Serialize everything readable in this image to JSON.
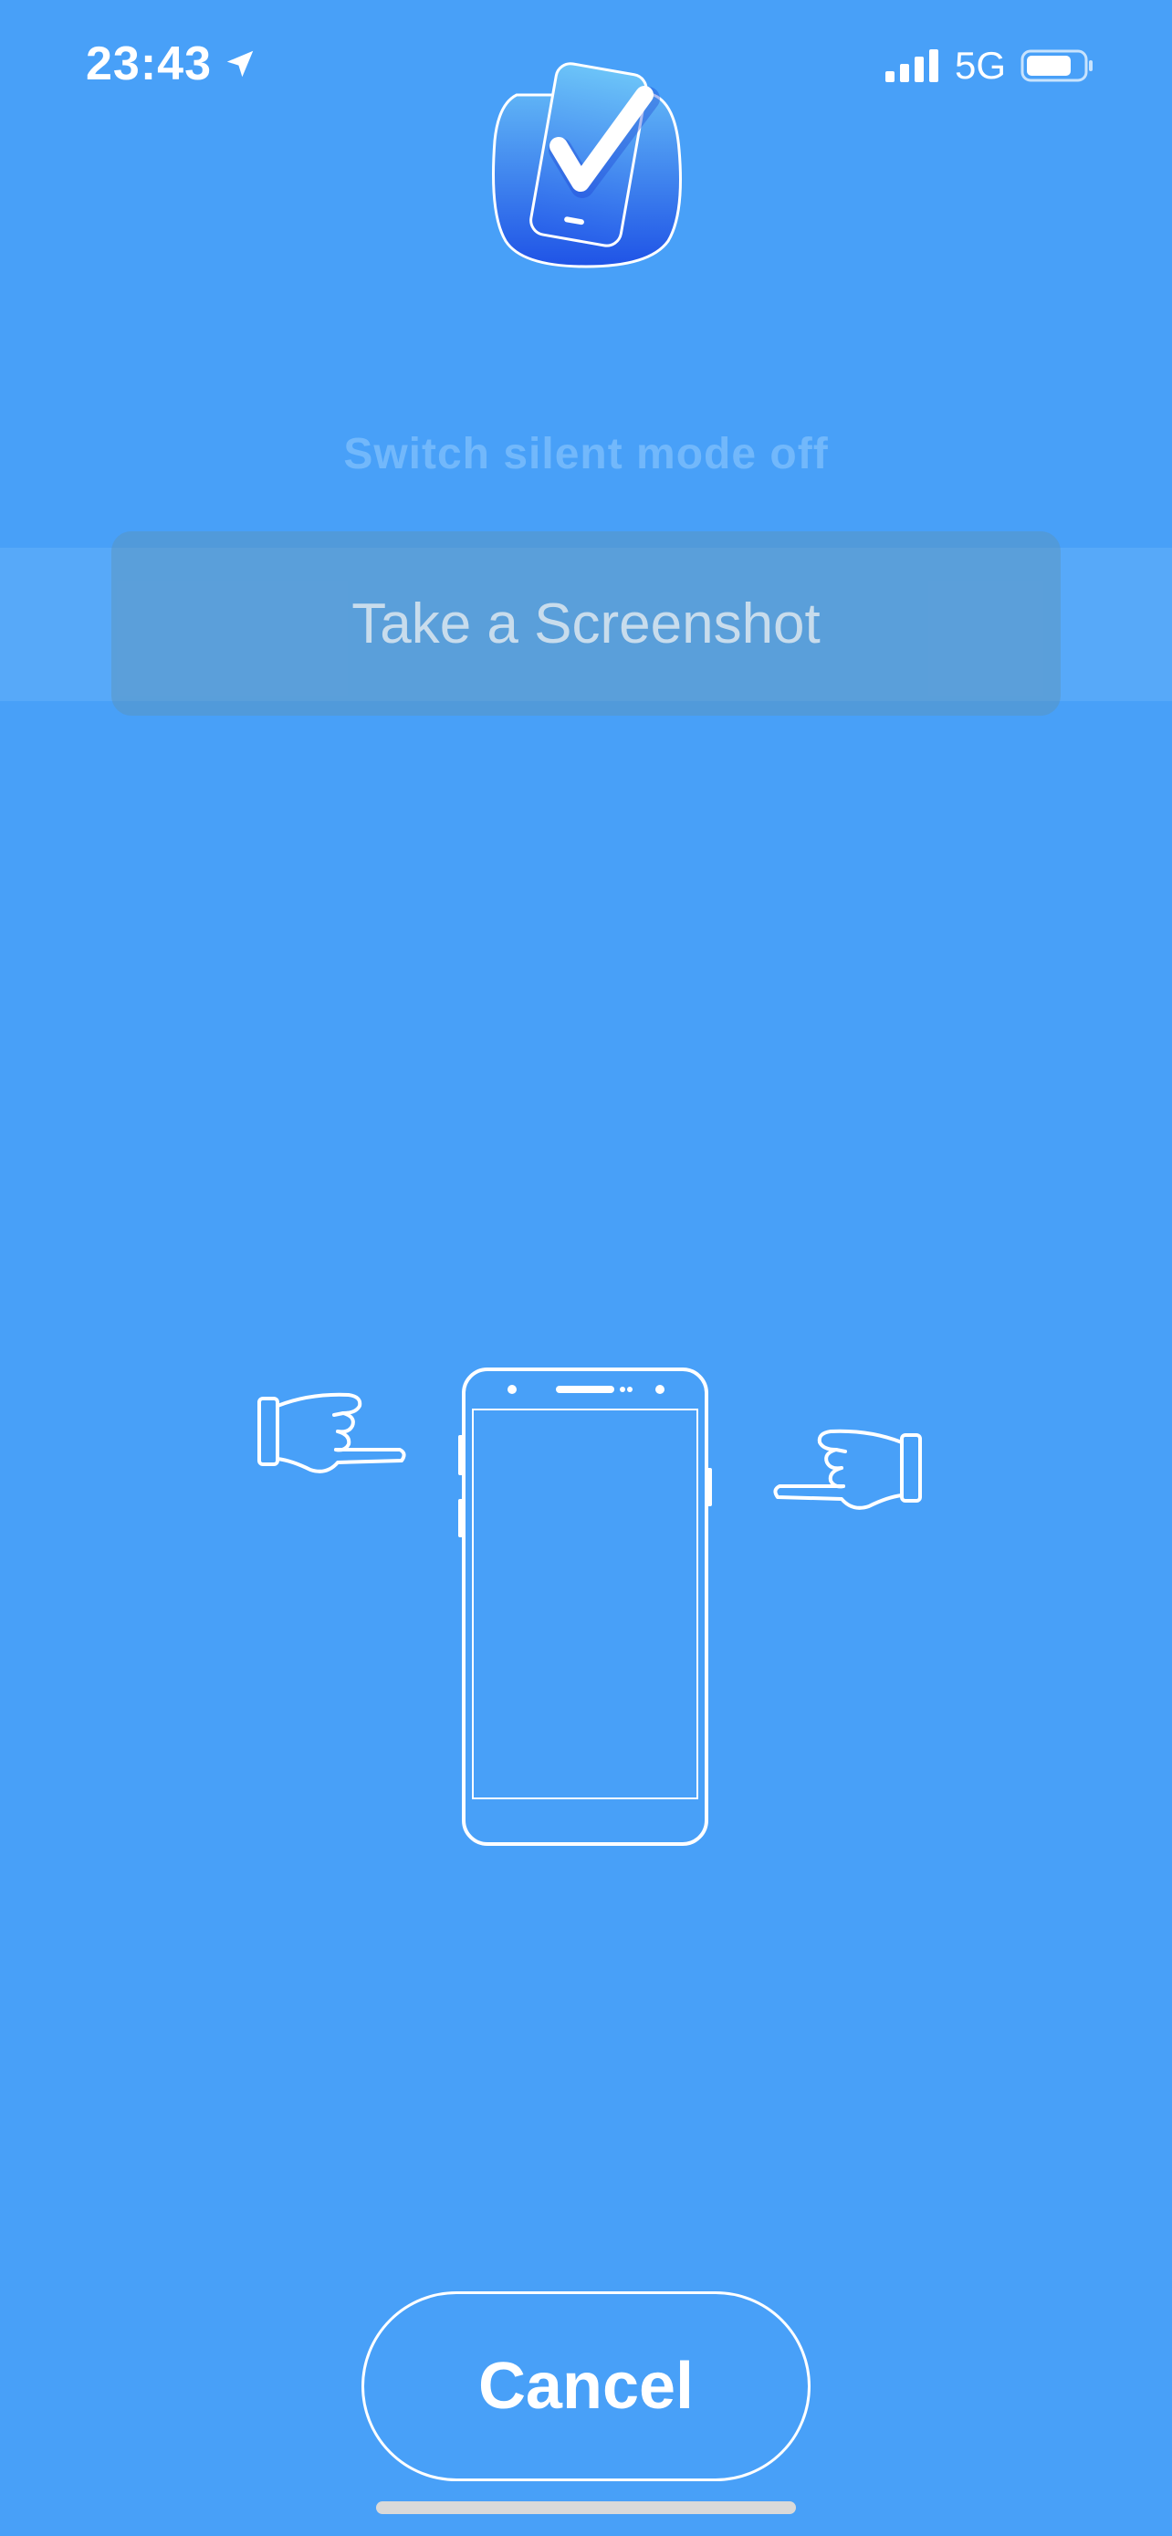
{
  "status_bar": {
    "time": "23:43",
    "network": "5G"
  },
  "icons": {
    "location": "location-arrow-icon",
    "signal": "cellular-signal-icon",
    "battery": "battery-icon",
    "app_logo": "phone-checkmark-logo-icon",
    "hand_left": "pointing-hand-right-icon",
    "hand_right": "pointing-hand-left-icon",
    "phone": "phone-outline-icon"
  },
  "main": {
    "silent_mode_text": "Switch silent mode off",
    "screenshot_button_label": "Take a Screenshot"
  },
  "footer": {
    "cancel_label": "Cancel"
  },
  "colors": {
    "background": "#48a0f8",
    "highlight_band": "#57a9f9",
    "logo_gradient_top": "#5fb3f6",
    "logo_gradient_bottom": "#1f53e6"
  }
}
